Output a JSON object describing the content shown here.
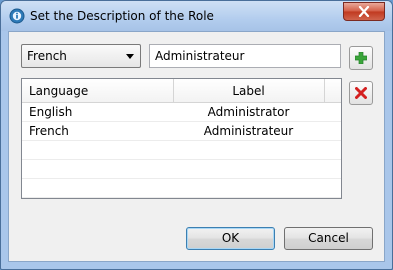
{
  "window": {
    "title": "Set the Description of the Role",
    "app_icon": "info-circle-icon"
  },
  "form": {
    "language_select": {
      "selected": "French"
    },
    "label_input": {
      "value": "Administrateur"
    },
    "add_icon": "plus-icon",
    "delete_icon": "red-x-icon"
  },
  "table": {
    "columns": [
      "Language",
      "Label"
    ],
    "rows": [
      {
        "language": "English",
        "label": "Administrator"
      },
      {
        "language": "French",
        "label": "Administrateur"
      }
    ],
    "empty_rows": 3
  },
  "buttons": {
    "ok": "OK",
    "cancel": "Cancel"
  },
  "colors": {
    "title_bar": "#b3cdee",
    "close_button": "#c0391f",
    "add_icon": "#3aa53a",
    "delete_icon": "#d42020",
    "ok_focus_border": "#3c7fb1"
  }
}
